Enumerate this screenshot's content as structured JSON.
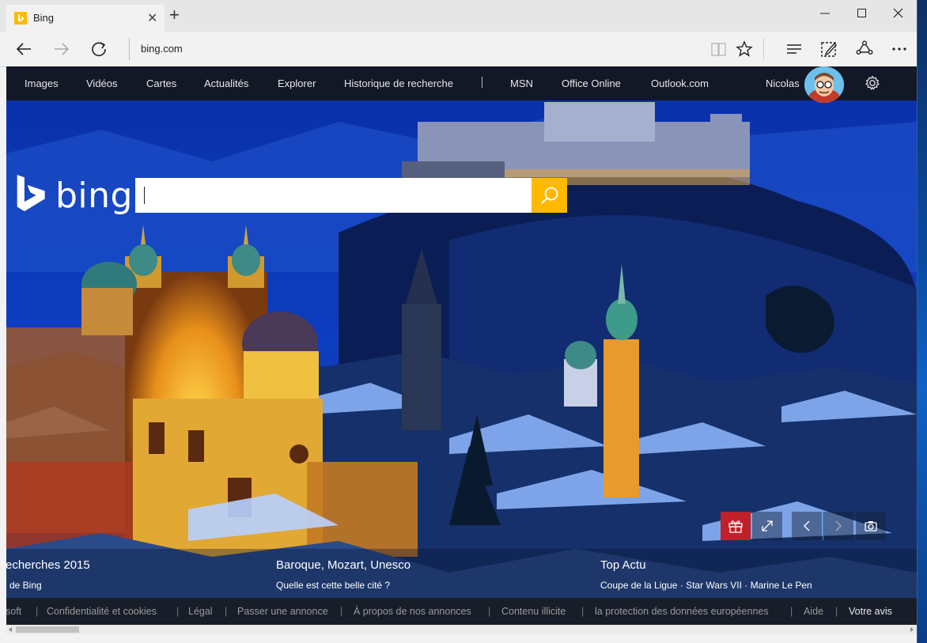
{
  "browser": {
    "tab_title": "Bing",
    "new_tab_symbol": "+",
    "address": "bing.com",
    "window_controls": [
      "minimize",
      "maximize",
      "close"
    ]
  },
  "bing": {
    "logo_text": "bing",
    "nav_left": [
      "Images",
      "Vidéos",
      "Cartes",
      "Actualités",
      "Explorer",
      "Historique de recherche"
    ],
    "nav_right": [
      "MSN",
      "Office Online",
      "Outlook.com"
    ],
    "user_name": "Nicolas",
    "search_value": "",
    "search_placeholder": "",
    "info": [
      {
        "title": "echerches 2015",
        "sub": "de Bing"
      },
      {
        "title": "Baroque, Mozart, Unesco",
        "sub": "Quelle est cette belle cité ?"
      },
      {
        "title": "Top Actu",
        "sub": "Coupe de la Ligue · Star Wars VII · Marine Le Pen"
      }
    ],
    "footer": [
      "soft",
      "Confidentialité et cookies",
      "Légal",
      "Passer une annonce",
      "À propos de nos annonces",
      "Contenu illicite",
      "la protection des données européennes",
      "Aide",
      "Votre avis"
    ]
  },
  "colors": {
    "accent": "#ffb900",
    "gift": "#c0202a",
    "nav_bg": "#141414"
  }
}
